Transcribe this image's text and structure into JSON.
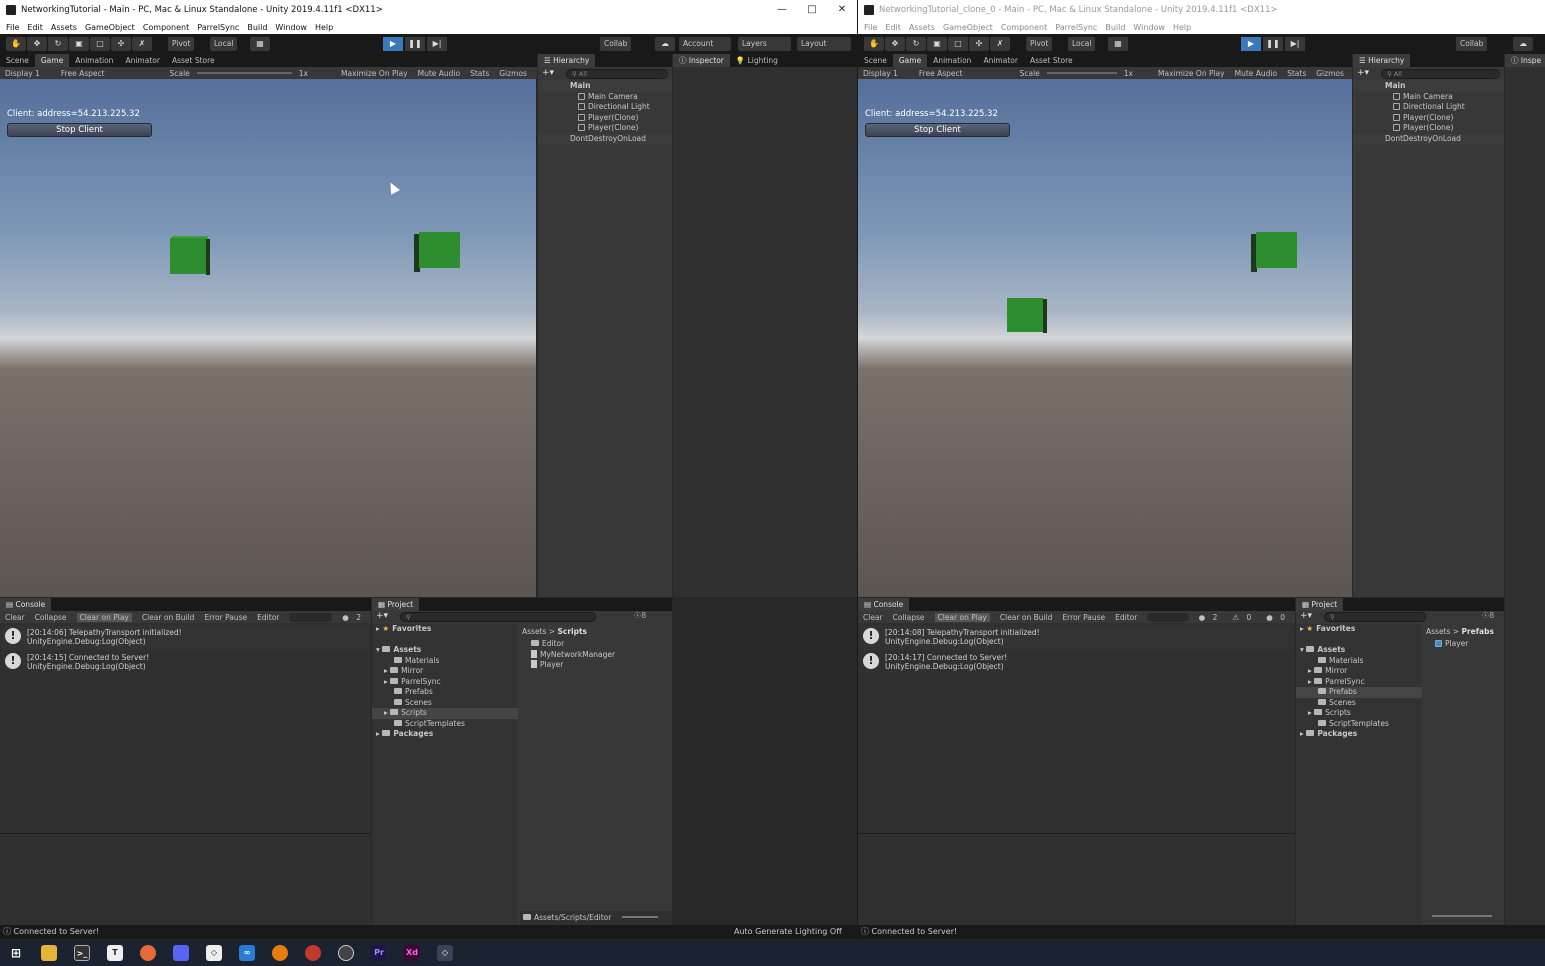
{
  "left_window": {
    "title": "NetworkingTutorial - Main - PC, Mac & Linux Standalone - Unity 2019.4.11f1 <DX11>",
    "menu": [
      "File",
      "Edit",
      "Assets",
      "GameObject",
      "Component",
      "ParrelSync",
      "Build",
      "Window",
      "Help"
    ],
    "toolbar": {
      "pivot": "Pivot",
      "local": "Local",
      "collab": "Collab",
      "account": "Account",
      "layers": "Layers",
      "layout": "Layout"
    },
    "view_tabs": [
      "Scene",
      "Game",
      "Animation",
      "Animator",
      "Asset Store"
    ],
    "game_bar": {
      "display": "Display 1",
      "aspect": "Free Aspect",
      "scale_label": "Scale",
      "scale_value": "1x",
      "maximize": "Maximize On Play",
      "mute": "Mute Audio",
      "stats": "Stats",
      "gizmos": "Gizmos"
    },
    "game": {
      "client_label": "Client: address=54.213.225.32",
      "stop_button": "Stop Client"
    },
    "hierarchy": {
      "tab": "Hierarchy",
      "search_placeholder": "All",
      "scene": "Main",
      "items": [
        "Main Camera",
        "Directional Light",
        "Player(Clone)",
        "Player(Clone)"
      ],
      "ddol": "DontDestroyOnLoad"
    },
    "inspector": {
      "tab_inspector": "Inspector",
      "tab_lighting": "Lighting"
    },
    "console": {
      "tab": "Console",
      "buttons": [
        "Clear",
        "Collapse",
        "Clear on Play",
        "Clear on Build",
        "Error Pause",
        "Editor"
      ],
      "count": "2",
      "messages": [
        {
          "line1": "[20:14:06] TelepathyTransport initialized!",
          "line2": "UnityEngine.Debug:Log(Object)"
        },
        {
          "line1": "[20:14:15] Connected to Server!",
          "line2": "UnityEngine.Debug:Log(Object)"
        }
      ]
    },
    "project": {
      "tab": "Project",
      "favorites": "Favorites",
      "assets": "Assets",
      "folders": [
        "Materials",
        "Mirror",
        "ParrelSync",
        "Prefabs",
        "Scenes",
        "Scripts",
        "ScriptTemplates"
      ],
      "packages": "Packages",
      "breadcrumb_root": "Assets",
      "breadcrumb_current": "Scripts",
      "files": [
        "Editor",
        "MyNetworkManager",
        "Player"
      ],
      "path": "Assets/Scripts/Editor",
      "hidden_count": "8"
    },
    "status": "Connected to Server!",
    "status_right": "Auto Generate Lighting Off"
  },
  "right_window": {
    "title": "NetworkingTutorial_clone_0 - Main - PC, Mac & Linux Standalone - Unity 2019.4.11f1 <DX11>",
    "menu": [
      "File",
      "Edit",
      "Assets",
      "GameObject",
      "Component",
      "ParrelSync",
      "Build",
      "Window",
      "Help"
    ],
    "toolbar": {
      "pivot": "Pivot",
      "local": "Local",
      "collab": "Collab"
    },
    "view_tabs": [
      "Scene",
      "Game",
      "Animation",
      "Animator",
      "Asset Store"
    ],
    "game_bar": {
      "display": "Display 1",
      "aspect": "Free Aspect",
      "scale_label": "Scale",
      "scale_value": "1x",
      "maximize": "Maximize On Play",
      "mute": "Mute Audio",
      "stats": "Stats",
      "gizmos": "Gizmos"
    },
    "game": {
      "client_label": "Client: address=54.213.225.32",
      "stop_button": "Stop Client"
    },
    "hierarchy": {
      "tab": "Hierarchy",
      "search_placeholder": "All",
      "scene": "Main",
      "items": [
        "Main Camera",
        "Directional Light",
        "Player(Clone)",
        "Player(Clone)"
      ],
      "ddol": "DontDestroyOnLoad"
    },
    "inspector": {
      "tab_inspector": "Inspe"
    },
    "console": {
      "tab": "Console",
      "buttons": [
        "Clear",
        "Collapse",
        "Clear on Play",
        "Clear on Build",
        "Error Pause",
        "Editor"
      ],
      "counts": [
        "2",
        "0",
        "0"
      ],
      "messages": [
        {
          "line1": "[20:14:08] TelepathyTransport initialized!",
          "line2": "UnityEngine.Debug:Log(Object)"
        },
        {
          "line1": "[20:14:17] Connected to Server!",
          "line2": "UnityEngine.Debug:Log(Object)"
        }
      ]
    },
    "project": {
      "tab": "Project",
      "favorites": "Favorites",
      "assets": "Assets",
      "folders": [
        "Materials",
        "Mirror",
        "ParrelSync",
        "Prefabs",
        "Scenes",
        "Scripts",
        "ScriptTemplates"
      ],
      "packages": "Packages",
      "breadcrumb_root": "Assets",
      "breadcrumb_current": "Prefabs",
      "files": [
        "Player"
      ],
      "hidden_count": "8"
    },
    "status": "Connected to Server!"
  },
  "taskbar": {
    "apps": [
      "windows-start",
      "file-explorer",
      "terminal",
      "notes",
      "firefox",
      "discord",
      "unity",
      "vscode",
      "blender",
      "app",
      "obs",
      "Pr",
      "Xd",
      "unity-active"
    ]
  },
  "colors": {
    "accent": "#3a79bb",
    "cube_green": "#2d8e2f",
    "editor_bg": "#282828",
    "panel_bg": "#383838"
  }
}
